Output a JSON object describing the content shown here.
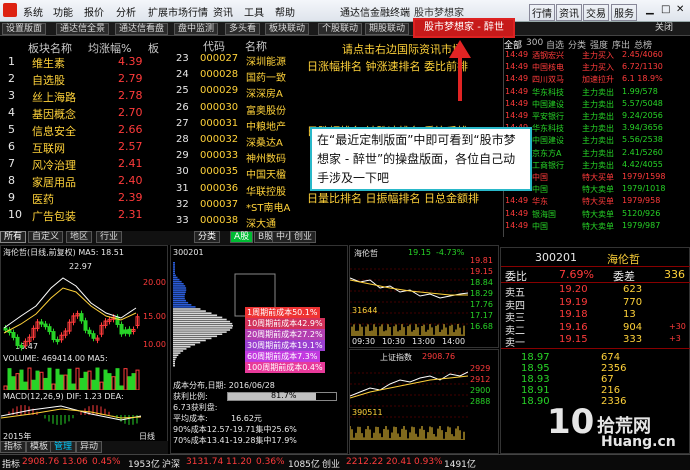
{
  "menu": [
    "系统",
    "功能",
    "报价",
    "分析",
    "扩展市场行情",
    "资讯",
    "工具",
    "帮助"
  ],
  "app_title": "通达信金融终端",
  "app_title2": "股市梦想家",
  "right_menu": [
    "行情",
    "资讯",
    "交易",
    "服务"
  ],
  "tabs": [
    "设置版面",
    "通达信全景",
    "通达信看盘",
    "盘中监测",
    "多头看",
    "板块联动",
    "个股联动",
    "期股联动"
  ],
  "red_tab": "股市梦想家 - 醉世",
  "close_label": "关闭",
  "sector": {
    "col_name": "板块名称",
    "col_chg": "均涨幅%",
    "col3": "板",
    "rows": [
      {
        "n": "1",
        "name": "维生素",
        "v": "4.39"
      },
      {
        "n": "2",
        "name": "自选股",
        "v": "2.79"
      },
      {
        "n": "3",
        "name": "丝上海路",
        "v": "2.78"
      },
      {
        "n": "4",
        "name": "基因概念",
        "v": "2.70"
      },
      {
        "n": "5",
        "name": "信息安全",
        "v": "2.66"
      },
      {
        "n": "6",
        "name": "互联网",
        "v": "2.57"
      },
      {
        "n": "7",
        "name": "风冷治理",
        "v": "2.41"
      },
      {
        "n": "8",
        "name": "家居用品",
        "v": "2.40"
      },
      {
        "n": "9",
        "name": "医药",
        "v": "2.39"
      },
      {
        "n": "10",
        "name": "广告包装",
        "v": "2.31"
      }
    ]
  },
  "stocks": {
    "col_code": "代码",
    "col_name": "名称",
    "rows": [
      {
        "n": "23",
        "code": "000027",
        "name": "深圳能源"
      },
      {
        "n": "24",
        "code": "000028",
        "name": "国药一致"
      },
      {
        "n": "25",
        "code": "000029",
        "name": "深深房A"
      },
      {
        "n": "26",
        "code": "000030",
        "name": "富奥股份"
      },
      {
        "n": "27",
        "code": "000031",
        "name": "中粮地产"
      },
      {
        "n": "28",
        "code": "000032",
        "name": "深桑达A"
      },
      {
        "n": "29",
        "code": "000033",
        "name": "神州数码"
      },
      {
        "n": "30",
        "code": "000035",
        "name": "中国天楹"
      },
      {
        "n": "31",
        "code": "000036",
        "name": "华联控股"
      },
      {
        "n": "32",
        "code": "000037",
        "name": "*ST南电A"
      },
      {
        "n": "33",
        "code": "000038",
        "name": "深大通"
      }
    ]
  },
  "center_text": {
    "l1": "请点击右边国际资讯市场",
    "l2": "日涨幅排名 钟涨速排名 委比前排",
    "l3": "日跌幅排名 钟跌速排名 委比后排",
    "l4": "日量比排名 日振幅排名 日总金额排"
  },
  "callout_text": "在“最近定制版面”中即可看到“股市梦想家 - 醉世”的操盘版面，各位自己动手涉及一下吧",
  "right_tabs": [
    "全部",
    "300",
    "自选",
    "分类",
    "强度",
    "序出",
    "总榜"
  ],
  "trades": [
    {
      "t": "14:49",
      "n": "酒钢宏兴",
      "a": "主力买入",
      "p": "2.45/4060"
    },
    {
      "t": "14:49",
      "n": "中国核电",
      "a": "主力买入",
      "p": "6.72/1130"
    },
    {
      "t": "14:49",
      "n": "四川双马",
      "a": "加速拉升",
      "p": "6.1 18.9%"
    },
    {
      "t": "14:49",
      "n": "华东科技",
      "a": "主力卖出",
      "p": "1.99/578"
    },
    {
      "t": "14:49",
      "n": "中国建设",
      "a": "主力卖出",
      "p": "5.57/5048"
    },
    {
      "t": "14:49",
      "n": "平安银行",
      "a": "主力卖出",
      "p": "9.24/2056"
    },
    {
      "t": "14:49",
      "n": "华东科技",
      "a": "主力卖出",
      "p": "3.94/3656"
    },
    {
      "t": "14:49",
      "n": "中国建设",
      "a": "主力卖出",
      "p": "5.56/2538"
    },
    {
      "t": "14:49",
      "n": "京东方A",
      "a": "主力卖出",
      "p": "2.41/5260"
    },
    {
      "t": "14:49",
      "n": "工商银行",
      "a": "主力卖出",
      "p": "4.42/4055"
    },
    {
      "t": "14:49",
      "n": "中国",
      "a": "特大买单",
      "p": "1979/1598"
    },
    {
      "t": "14:49",
      "n": "中国",
      "a": "特大卖单",
      "p": "1979/1018"
    },
    {
      "t": "14:49",
      "n": "华东",
      "a": "特大买单",
      "p": "1979/958"
    },
    {
      "t": "14:49",
      "n": "银海国",
      "a": "特大卖单",
      "p": "5120/926"
    },
    {
      "t": "14:49",
      "n": "中国",
      "a": "特大卖单",
      "p": "1979/987"
    }
  ],
  "left_bottom_tabs": [
    "所有",
    "自定义",
    "地区",
    "行业"
  ],
  "chart_tabs": [
    "分类",
    "A股",
    "B股",
    "中小",
    "创业"
  ],
  "kline": {
    "title": "海伦哲(日线,前复权) MA5: 18.51",
    "p_high": "22.97",
    "p_low": "10.47",
    "vol": "VOLUME: 469414.00 MA5:",
    "macd": "MACD(12,26,9) DIF: 1.23 DEA:",
    "year": "2015年",
    "labels": [
      "20.00",
      "15.00",
      "10.00"
    ],
    "mark": "日线"
  },
  "chip": {
    "code": "300201",
    "rows": [
      "1周期前成本50.1%",
      "10周期前成本42.9%",
      "20周期前成本27.2%",
      "30周期前成本19.1%",
      "60周期前成本7.3%",
      "100周期前成本0.4%"
    ],
    "date": "成本分布,日期: 2016/06/28",
    "profit": "获利比例:",
    "profit_v": "81.7%",
    "avg_cost": "6.73获利盘:",
    "avg": "平均成本:",
    "avg_v": "16.62元",
    "c90": "90%成本12.57-19.71集中25.6%",
    "c70": "70%成本13.41-19.28集中17.9%"
  },
  "mini1": {
    "name": "海伦哲",
    "price": "19.15",
    "chg": "-4.73%",
    "v1": "31644",
    "time": "09:30",
    "t2": "10:30",
    "t3": "13:00",
    "t4": "14:00",
    "ticks": [
      "19.81",
      "19.15",
      "18.84",
      "18.29",
      "17.76",
      "17.17",
      "16.68"
    ]
  },
  "mini2": {
    "name": "上证指数",
    "price": "2908.76",
    "v1": "390511",
    "ticks": [
      "2929",
      "2912",
      "2900",
      "2888"
    ]
  },
  "quote": {
    "code": "300201",
    "name": "海伦哲",
    "wb_label": "委比",
    "wb": "7.69%",
    "wc_label": "委差",
    "wc": "336",
    "asks": [
      {
        "l": "卖五",
        "p": "19.20",
        "v": "623"
      },
      {
        "l": "卖四",
        "p": "19.19",
        "v": "770"
      },
      {
        "l": "卖三",
        "p": "19.18",
        "v": "13"
      },
      {
        "l": "卖二",
        "p": "19.16",
        "v": "904",
        "x": "+30"
      },
      {
        "l": "卖一",
        "p": "19.15",
        "v": "333",
        "x": "+3"
      }
    ],
    "ticks": [
      {
        "p": "18.97",
        "v": "674"
      },
      {
        "p": "18.95",
        "v": "2356"
      },
      {
        "p": "18.93",
        "v": "67"
      },
      {
        "p": "18.91",
        "v": "216"
      },
      {
        "p": "18.90",
        "v": "2336"
      }
    ]
  },
  "status": {
    "zs": "指标",
    "zs_v": "2908.76",
    "zs_c": "13.06",
    "zs_p": "0.45%",
    "zs_a": "1953亿",
    "sz": "沪深",
    "sz_v": "3131.74",
    "sz_c": "11.20",
    "sz_p": "0.36%",
    "sz_a": "1085亿",
    "cy": "创业",
    "cy_v": "2212.22",
    "cy_c": "20.41",
    "cy_p": "0.93%",
    "cy_a": "1491亿"
  },
  "watermark": {
    "big": "10",
    "site": "拾荒网",
    "url": "Huang.cn"
  },
  "bottom_left_tabs": [
    "指标",
    "模板",
    "管理",
    "异动"
  ],
  "colors": {
    "accent": "#ff3b3b",
    "down": "#27d327",
    "highlight": "#ffd23a",
    "callout_border": "#29b8c9"
  }
}
